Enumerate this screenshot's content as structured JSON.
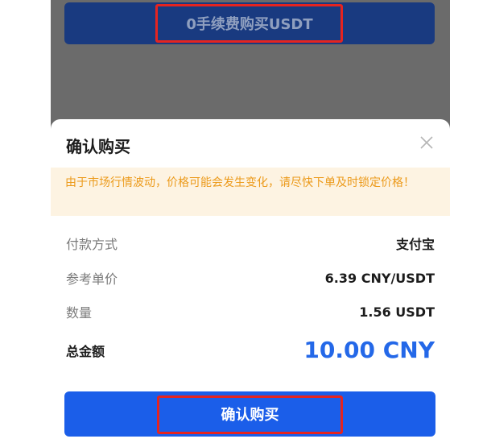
{
  "top_button": {
    "label": "0手续费购买USDT"
  },
  "dialog": {
    "title": "确认购买",
    "warning": "由于市场行情波动，价格可能会发生变化，请尽快下单及时锁定价格！",
    "rows": [
      {
        "label": "付款方式",
        "value": "支付宝"
      },
      {
        "label": "参考单价",
        "value": "6.39 CNY/USDT"
      },
      {
        "label": "数量",
        "value": "1.56 USDT"
      }
    ],
    "total": {
      "label": "总金额",
      "value": "10.00 CNY"
    },
    "confirm_label": "确认购买"
  },
  "colors": {
    "overlay": "#6b6b6b",
    "top_button_bg": "#193a80",
    "warning_text": "#ec9a1a",
    "warning_bg": "#fdf3e2",
    "accent_blue": "#2468e8",
    "confirm_bg": "#1b5ee9",
    "highlight_red": "#e52420"
  }
}
